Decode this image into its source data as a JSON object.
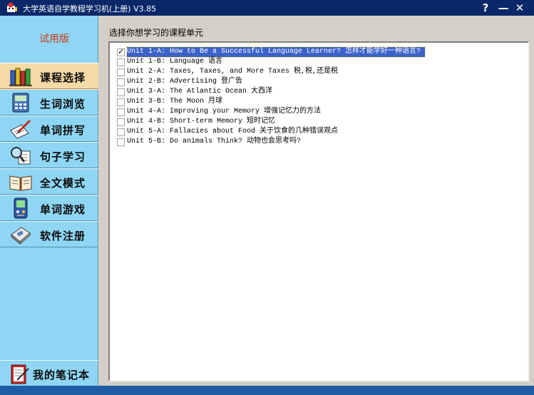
{
  "window": {
    "title": "大学英语自学教程学习机(上册) V3.85",
    "help_label": "?",
    "minimize_label": "—",
    "close_label": "✕"
  },
  "sidebar": {
    "trial_label": "试用版",
    "items": [
      {
        "label": "课程选择",
        "icon": "books-icon",
        "active": true
      },
      {
        "label": "生词浏览",
        "icon": "dictionary-device-icon",
        "active": false
      },
      {
        "label": "单词拼写",
        "icon": "pen-writing-icon",
        "active": false
      },
      {
        "label": "句子学习",
        "icon": "magnifier-icon",
        "active": false
      },
      {
        "label": "全文模式",
        "icon": "open-book-icon",
        "active": false
      },
      {
        "label": "单词游戏",
        "icon": "handheld-game-icon",
        "active": false
      },
      {
        "label": "软件注册",
        "icon": "register-card-icon",
        "active": false
      }
    ],
    "notebook_label": "我的笔记本",
    "notebook_icon": "notebook-icon"
  },
  "main": {
    "title": "选择你想学习的课程单元",
    "units": [
      {
        "text": "Unit 1-A: How to Be a Successful Language Learner?  怎样才能学好一种语言?",
        "checked": true,
        "selected": true
      },
      {
        "text": "Unit 1-B: Language  语言",
        "checked": false,
        "selected": false
      },
      {
        "text": "Unit 2-A: Taxes, Taxes, and More Taxes  税,税,还是税",
        "checked": false,
        "selected": false
      },
      {
        "text": "Unit 2-B: Advertising  登广告",
        "checked": false,
        "selected": false
      },
      {
        "text": "Unit 3-A: The Atlantic Ocean  大西洋",
        "checked": false,
        "selected": false
      },
      {
        "text": "Unit 3-B: The Moon  月球",
        "checked": false,
        "selected": false
      },
      {
        "text": "Unit 4-A: Improving your Memory  增强记忆力的方法",
        "checked": false,
        "selected": false
      },
      {
        "text": "Unit 4-B: Short-term Memory  短时记忆",
        "checked": false,
        "selected": false
      },
      {
        "text": "Unit 5-A: Fallacies about Food  关于饮食的几种错误观点",
        "checked": false,
        "selected": false
      },
      {
        "text": "Unit 5-B: Do animals Think?  动物也会思考吗?",
        "checked": false,
        "selected": false
      }
    ]
  },
  "colors": {
    "titlebar": "#0a2868",
    "sidebar": "#8fd6f4",
    "active_item": "#f5d9a6",
    "trial_text": "#c83c14",
    "selection": "#3b62c8",
    "statusbar": "#1e5ca4"
  }
}
